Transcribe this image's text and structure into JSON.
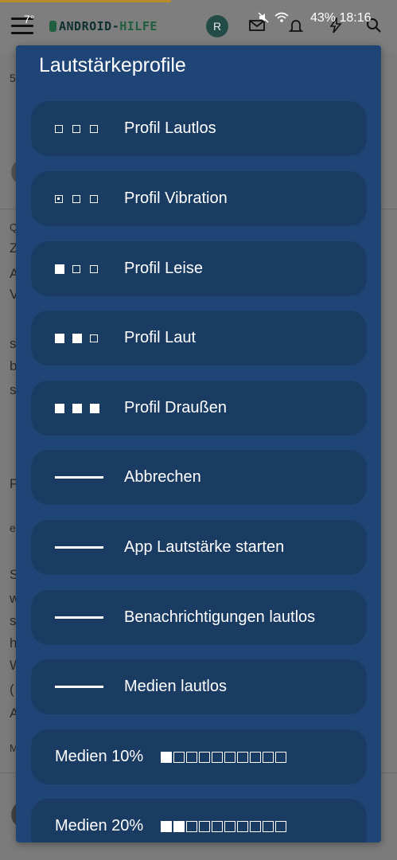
{
  "status_bar": {
    "temperature": "7°",
    "battery": "43%",
    "time": "18:16",
    "avatar_initial": "R"
  },
  "app": {
    "logo_part1": "ANDROID-",
    "logo_part2": "HILFE"
  },
  "background": {
    "snippets": [
      "5",
      "Z",
      "A",
      "V",
      "s",
      "b",
      "s",
      "P",
      "e",
      "S",
      "w",
      "s",
      "h",
      "W",
      "(",
      "A",
      "M",
      "Q"
    ]
  },
  "dialog": {
    "title": "Lautstärkeprofile",
    "items": [
      {
        "label": "Profil Lautlos",
        "icon": "volume-level-0-icon",
        "level": 0
      },
      {
        "label": "Profil Vibration",
        "icon": "vibration-level-icon",
        "level": 0
      },
      {
        "label": "Profil Leise",
        "icon": "volume-level-1-icon",
        "level": 1
      },
      {
        "label": "Profil Laut",
        "icon": "volume-level-2-icon",
        "level": 2
      },
      {
        "label": "Profil Draußen",
        "icon": "volume-level-3-icon",
        "level": 3
      },
      {
        "label": "Abbrechen",
        "icon": "dash-line-icon"
      },
      {
        "label": "App Lautstärke starten",
        "icon": "dash-line-icon"
      },
      {
        "label": "Benachrichtigungen lautlos",
        "icon": "dash-line-icon"
      },
      {
        "label": "Medien lautlos",
        "icon": "dash-line-icon"
      },
      {
        "label": "Medien 10%",
        "bar_filled": 1,
        "bar_total": 10
      },
      {
        "label": "Medien 20%",
        "bar_filled": 2,
        "bar_total": 10
      }
    ]
  },
  "colors": {
    "dialog_bg": "#1e4575",
    "item_bg": "#1a3b62",
    "text": "#ffffff"
  }
}
